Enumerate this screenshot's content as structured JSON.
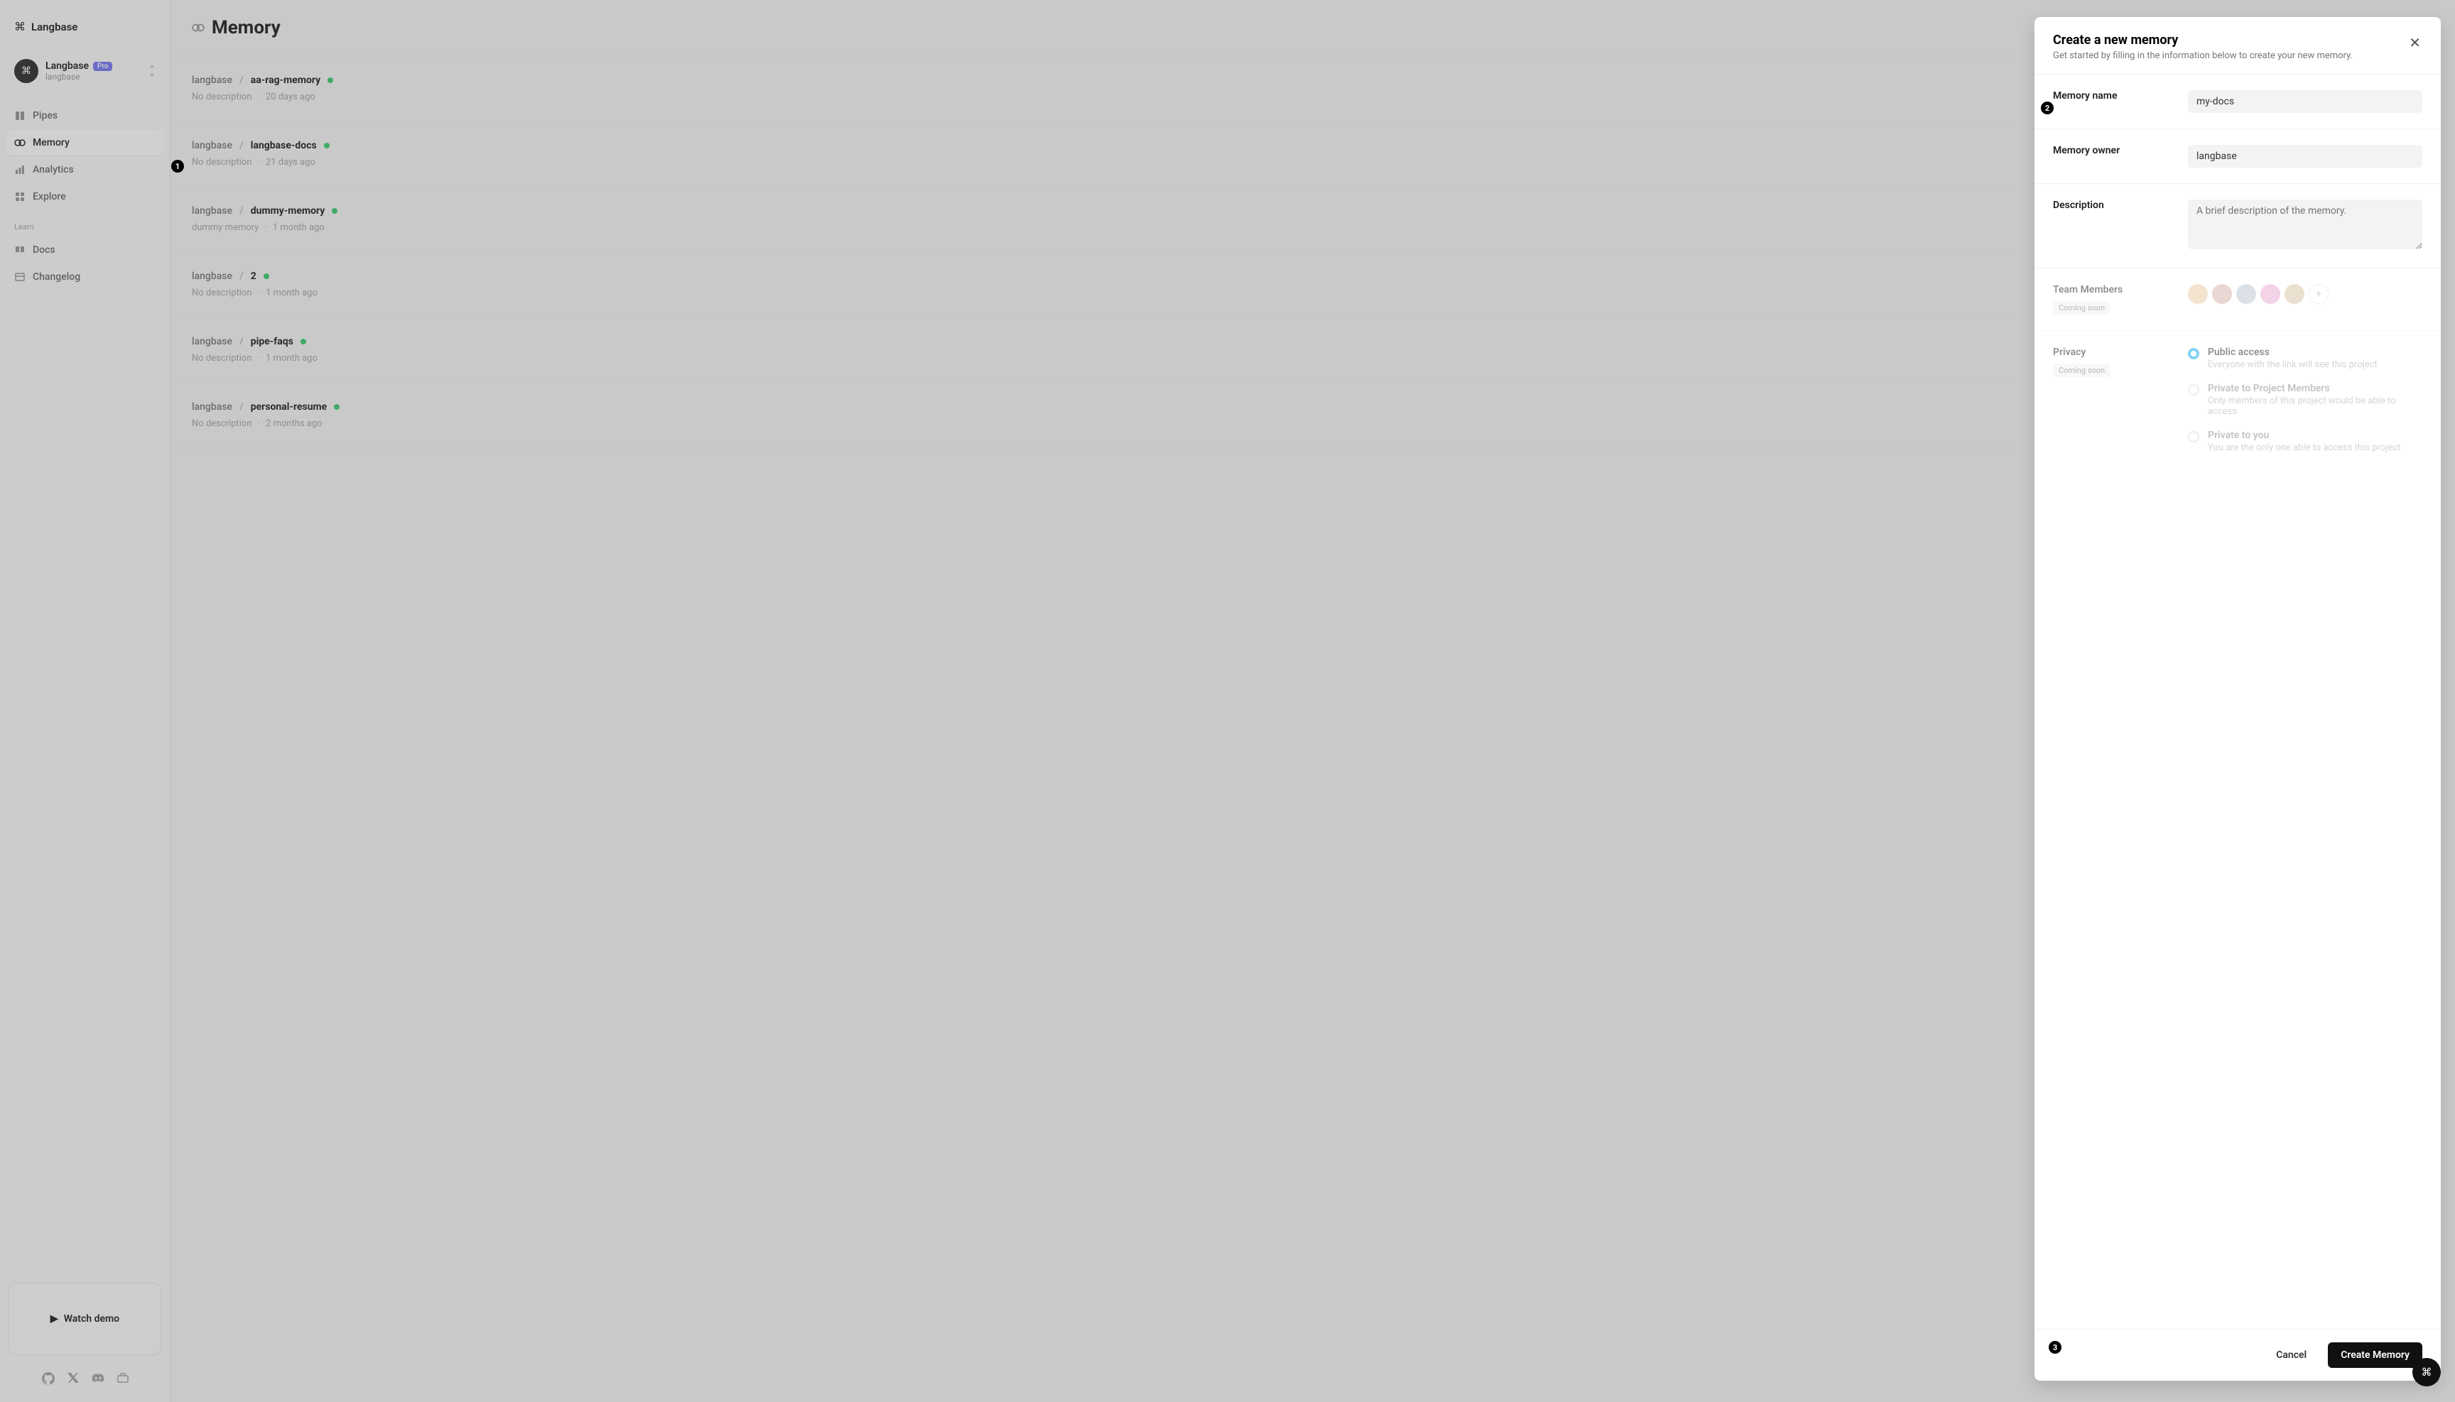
{
  "brand": {
    "name": "Langbase",
    "cmd_glyph": "⌘"
  },
  "org": {
    "name": "Langbase",
    "sub": "langbase",
    "badge": "Pro"
  },
  "sidebar": {
    "nav": [
      {
        "label": "Pipes"
      },
      {
        "label": "Memory"
      },
      {
        "label": "Analytics"
      },
      {
        "label": "Explore"
      }
    ],
    "learn_label": "Learn",
    "learn": [
      {
        "label": "Docs"
      },
      {
        "label": "Changelog"
      }
    ],
    "watch_demo": "Watch demo"
  },
  "page": {
    "title": "Memory"
  },
  "memories": [
    {
      "owner": "langbase",
      "name": "aa-rag-memory",
      "desc": "No description",
      "time": "20 days ago"
    },
    {
      "owner": "langbase",
      "name": "langbase-docs",
      "desc": "No description",
      "time": "21 days ago"
    },
    {
      "owner": "langbase",
      "name": "dummy-memory",
      "desc": "dummy memory",
      "time": "1 month ago"
    },
    {
      "owner": "langbase",
      "name": "2",
      "desc": "No description",
      "time": "1 month ago"
    },
    {
      "owner": "langbase",
      "name": "pipe-faqs",
      "desc": "No description",
      "time": "1 month ago"
    },
    {
      "owner": "langbase",
      "name": "personal-resume",
      "desc": "No description",
      "time": "2 months ago"
    }
  ],
  "modal": {
    "title": "Create a new memory",
    "subtitle": "Get started by filling in the information below to create your new memory.",
    "fields": {
      "name_label": "Memory name",
      "name_value": "my-docs",
      "owner_label": "Memory owner",
      "owner_value": "langbase",
      "desc_label": "Description",
      "desc_placeholder": "A brief description of the memory.",
      "team_label": "Team Members",
      "privacy_label": "Privacy",
      "coming_soon": "Coming soon"
    },
    "privacy_options": [
      {
        "title": "Public access",
        "desc": "Everyone with the link will see this project"
      },
      {
        "title": "Private to Project Members",
        "desc": "Only members of this project would be able to access"
      },
      {
        "title": "Private to you",
        "desc": "You are the only one able to access this project"
      }
    ],
    "cancel": "Cancel",
    "create": "Create Memory"
  },
  "steps": [
    "1",
    "2",
    "3"
  ],
  "avatar_colors": [
    "#e8c8a0",
    "#d4b0a8",
    "#b8c4d0",
    "#e8a8d0",
    "#d8c0a0"
  ]
}
